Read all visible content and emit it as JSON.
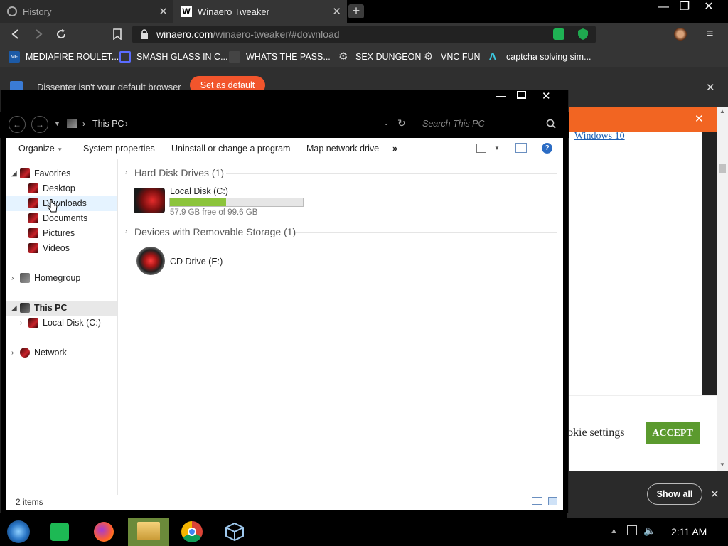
{
  "browser": {
    "tabs": [
      {
        "label": "History"
      },
      {
        "label": "Winaero Tweaker"
      }
    ],
    "url": {
      "host": "winaero.com",
      "path": "/winaero-tweaker/#download"
    },
    "bookmarks": [
      {
        "label": "MEDIAFIRE ROULET...",
        "icon": "mediafire-icon"
      },
      {
        "label": "SMASH GLASS IN C...",
        "icon": "blue-chevron-icon"
      },
      {
        "label": "WHATS THE PASS...",
        "icon": "dark-square-icon"
      },
      {
        "label": "SEX DUNGEON",
        "icon": "gear-icon"
      },
      {
        "label": "VNC FUN",
        "icon": "gear-icon"
      },
      {
        "label": "captcha solving sim...",
        "icon": "lambda-icon"
      }
    ],
    "notice": {
      "text": "Dissenter isn't your default browser",
      "button": "Set as default"
    }
  },
  "page_behind": {
    "link_text": "Windows 10",
    "cookie_settings": "okie settings",
    "accept": "ACCEPT",
    "show_all": "Show all"
  },
  "explorer": {
    "breadcrumb": "This PC",
    "search_placeholder": "Search This PC",
    "commands": [
      "Organize",
      "System properties",
      "Uninstall or change a program",
      "Map network drive"
    ],
    "overflow": "»",
    "nav": {
      "favorites": "Favorites",
      "favorites_items": [
        "Desktop",
        "Downloads",
        "Documents",
        "Pictures",
        "Videos"
      ],
      "homegroup": "Homegroup",
      "thispc": "This PC",
      "thispc_child": "Local Disk (C:)",
      "network": "Network"
    },
    "groups": {
      "hdd_title": "Hard Disk Drives (1)",
      "removable_title": "Devices with Removable Storage (1)"
    },
    "local_disk": {
      "name": "Local Disk (C:)",
      "free_text": "57.9 GB free of 99.6 GB",
      "used_fraction": 0.42
    },
    "cd_drive": {
      "name": "CD Drive (E:)"
    },
    "status": "2 items"
  },
  "taskbar": {
    "time": "2:11 AM"
  },
  "colors": {
    "orange": "#f26522",
    "accept_green": "#5b9a2e",
    "disk_bar": "#8cc43c"
  }
}
